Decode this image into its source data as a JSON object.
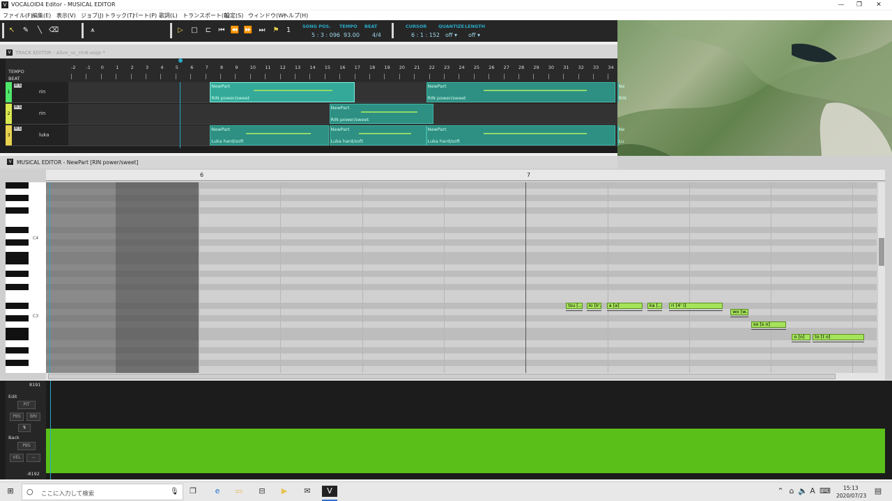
{
  "window": {
    "title": "VOCALOID4 Editor - MUSICAL EDITOR",
    "app_icon": "V"
  },
  "menu": [
    "ファイル(F)",
    "編集(E)",
    "表示(V)",
    "ジョブ(J)",
    "トラック(T)",
    "パート(P)",
    "歌詞(L)",
    "トランスポート(R)",
    "設定(S)",
    "ウィンドウ(W)",
    "ヘルプ(H)"
  ],
  "toolbar": {
    "song_pos_label": "SONG POS.",
    "song_pos": "5 : 3 : 096",
    "tempo_label": "TEMPO",
    "tempo": "93.00",
    "beat_label": "BEAT",
    "beat": "4/4",
    "cursor_label": "CURSOR",
    "cursor": "6 : 1 : 152",
    "quantize_label": "QUANTIZE",
    "quantize": "off ▾",
    "length_label": "LENGTH",
    "length": "off ▾",
    "metronome_label": "1",
    "tempo_track_label": "TEMPO",
    "beat_track_label": "BEAT"
  },
  "track_editor": {
    "title": "TRACK EDITOR - Alive_vc_rin6.vsqx *",
    "ruler": [
      "-2",
      "-1",
      "0",
      "1",
      "2",
      "3",
      "4",
      "5",
      "6",
      "7",
      "8",
      "9",
      "10",
      "11",
      "12",
      "13",
      "14",
      "15",
      "16",
      "17",
      "18",
      "19",
      "20",
      "21",
      "22",
      "23",
      "24",
      "25",
      "26",
      "27",
      "28",
      "29",
      "30",
      "31",
      "32",
      "33",
      "34"
    ],
    "tracks": [
      {
        "num": "1",
        "name": "rin",
        "color": "#4ee86a",
        "parts": [
          {
            "name": "NewPart",
            "voice": "RIN power/sweet",
            "start": 7.5,
            "end": 17.2,
            "selected": true
          },
          {
            "name": "NewPart",
            "voice": "RIN power/sweet",
            "start": 22.0,
            "end": 34.7,
            "selected": false
          },
          {
            "name": "Ne",
            "voice": "RIN",
            "start": 34.8,
            "end": 36.0,
            "selected": false
          }
        ]
      },
      {
        "num": "2",
        "name": "rin",
        "color": "#d9e84e",
        "parts": [
          {
            "name": "NewPart",
            "voice": "RIN power/sweet",
            "start": 15.5,
            "end": 22.5,
            "selected": false
          }
        ]
      },
      {
        "num": "3",
        "name": "luka",
        "color": "#e8d24e",
        "parts": [
          {
            "name": "NewPart",
            "voice": "Luka hard/soft",
            "start": 7.5,
            "end": 15.5,
            "selected": false
          },
          {
            "name": "NewPart",
            "voice": "Luka hard/soft",
            "start": 15.5,
            "end": 22.0,
            "selected": false
          },
          {
            "name": "NewPart",
            "voice": "Luka hard/soft",
            "start": 22.0,
            "end": 34.7,
            "selected": false
          },
          {
            "name": "Ne",
            "voice": "Lu",
            "start": 34.8,
            "end": 36.0,
            "selected": false
          }
        ]
      }
    ]
  },
  "musical_editor": {
    "title": "MUSICAL EDITOR - NewPart [RIN power/sweet]",
    "ruler": [
      "6",
      "7"
    ],
    "key_labels": [
      "C4",
      "C3"
    ],
    "notes": [
      {
        "text": "tsu [...",
        "pos": 0.626,
        "len": 0.02,
        "row": 19
      },
      {
        "text": "ki [k'...",
        "pos": 0.651,
        "len": 0.018,
        "row": 19
      },
      {
        "text": "a [a]",
        "pos": 0.675,
        "len": 0.043,
        "row": 19
      },
      {
        "text": "ka [...",
        "pos": 0.724,
        "len": 0.018,
        "row": 19
      },
      {
        "text": "ri [4' i]",
        "pos": 0.75,
        "len": 0.065,
        "row": 19
      },
      {
        "text": "wo [w...",
        "pos": 0.824,
        "len": 0.022,
        "row": 20
      },
      {
        "text": "so [s o]",
        "pos": 0.849,
        "len": 0.042,
        "row": 22
      },
      {
        "text": "o [o]",
        "pos": 0.898,
        "len": 0.022,
        "row": 24
      },
      {
        "text": "to [t o]",
        "pos": 0.923,
        "len": 0.062,
        "row": 24
      }
    ]
  },
  "control": {
    "max": "8191",
    "min": "-8192",
    "edit_label": "Edit",
    "edit_value": "PIT",
    "pbs": "PBS",
    "bri": "BRI",
    "back_label": "Back",
    "back_value": "PBS",
    "vel": "VEL",
    "dash": "--"
  },
  "taskbar": {
    "search_placeholder": "ここに入力して検索",
    "ime": "A",
    "time": "15:13",
    "date": "2020/07/23"
  }
}
